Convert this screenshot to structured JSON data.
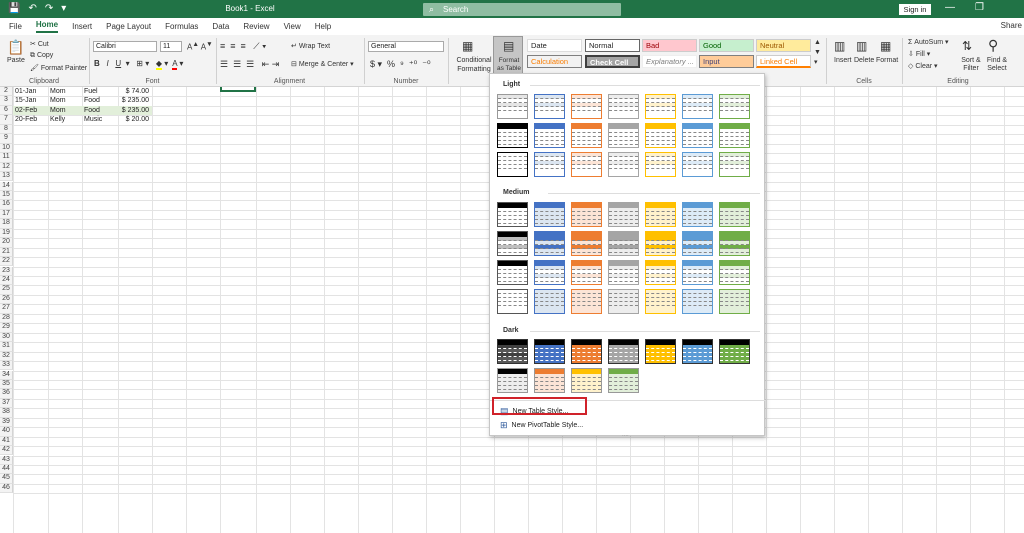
{
  "titlebar": {
    "title": "Book1 - Excel",
    "search": "Search",
    "signin": "Sign in",
    "icons": [
      "save-icon",
      "undo-icon",
      "redo-icon",
      "customize-icon"
    ]
  },
  "tabs": [
    "File",
    "Home",
    "Insert",
    "Page Layout",
    "Formulas",
    "Data",
    "Review",
    "View",
    "Help"
  ],
  "share": "Share",
  "ribbon": {
    "clipboard": {
      "paste": "Paste",
      "cut": "Cut",
      "copy": "Copy",
      "format_painter": "Format Painter",
      "label": "Clipboard"
    },
    "font": {
      "name": "Calibri",
      "size": "11",
      "label": "Font"
    },
    "alignment": {
      "wrap": "Wrap Text",
      "merge": "Merge & Center",
      "label": "Alignment"
    },
    "number": {
      "format": "General",
      "label": "Number"
    },
    "styles": {
      "conditional": "Conditional Formatting",
      "format_table": "Format as Table",
      "date": "Date",
      "normal": "Normal",
      "bad": "Bad",
      "good": "Good",
      "neutral": "Neutral",
      "calculation": "Calculation",
      "check_cell": "Check Cell",
      "explanatory": "Explanatory ...",
      "input": "Input",
      "linked_cell": "Linked Cell"
    },
    "cells": {
      "insert": "Insert",
      "delete": "Delete",
      "format": "Format",
      "label": "Cells"
    },
    "editing": {
      "autosum": "AutoSum",
      "fill": "Fill",
      "clear": "Clear",
      "sort": "Sort & Filter",
      "find": "Find & Select",
      "label": "Editing"
    }
  },
  "sheet": {
    "rows": [
      {
        "num": "2",
        "cells": [
          "01-Jan",
          "Mom",
          "Fuel",
          "$   74.00"
        ],
        "hl": false
      },
      {
        "num": "3",
        "cells": [
          "15-Jan",
          "Mom",
          "Food",
          "$ 235.00"
        ],
        "hl": false
      },
      {
        "num": "6",
        "cells": [
          "02-Feb",
          "Mom",
          "Food",
          "$ 235.00"
        ],
        "hl": true
      },
      {
        "num": "7",
        "cells": [
          "20-Feb",
          "Kelly",
          "Music",
          "$   20.00"
        ],
        "hl": false
      }
    ],
    "more_rows": [
      "10",
      "11",
      "12",
      "13",
      "14",
      "15",
      "16",
      "17",
      "18",
      "19",
      "20",
      "21",
      "22",
      "23",
      "24",
      "25",
      "26",
      "27",
      "28",
      "29",
      "30",
      "31",
      "32",
      "33",
      "34",
      "35",
      "36",
      "37",
      "38",
      "39",
      "40",
      "41",
      "42",
      "43",
      "44",
      "45",
      "46"
    ],
    "row_nums_visible": [
      "8",
      "9"
    ]
  },
  "dropdown": {
    "light": "Light",
    "medium": "Medium",
    "dark": "Dark",
    "new_table_style": "New Table Style...",
    "new_pivot_style": "New PivotTable Style..."
  },
  "colors": {
    "accent": "#217346",
    "series": [
      "#000000",
      "#4472c4",
      "#ed7d31",
      "#a5a5a5",
      "#ffc000",
      "#5b9bd5",
      "#70ad47"
    ]
  }
}
